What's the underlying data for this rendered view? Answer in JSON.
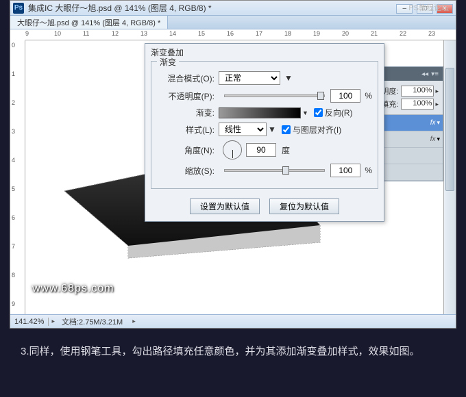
{
  "watermarks": {
    "top_right": "PS教程论坛",
    "bottom_left": "www.68ps.com"
  },
  "window": {
    "app_badge": "Ps",
    "title": "集成IC    大眼仔～旭.psd @ 141% (图层 4, RGB/8) *",
    "btn_min": "–",
    "btn_max": "□",
    "btn_close": "×"
  },
  "tabs": {
    "doc": "大眼仔～旭.psd @ 141% (图层 4, RGB/8) *"
  },
  "ruler_h": [
    "9",
    "10",
    "11",
    "12",
    "13",
    "14",
    "15",
    "16",
    "17",
    "18",
    "19",
    "20",
    "21",
    "22",
    "23"
  ],
  "ruler_v": [
    "0",
    "1",
    "2",
    "3",
    "4",
    "5",
    "6",
    "7",
    "8",
    "9"
  ],
  "statusbar": {
    "zoom": "141.42%",
    "docinfo": "文档:2.75M/3.21M"
  },
  "dialog": {
    "title": "渐变叠加",
    "group_title": "渐变",
    "blend_label": "混合模式(O):",
    "blend_value": "正常",
    "opacity_label": "不透明度(P):",
    "opacity_value": "100",
    "opacity_unit": "%",
    "gradient_label": "渐变:",
    "reverse_label": "反向(R)",
    "style_label": "样式(L):",
    "style_value": "线性",
    "align_label": "与图层对齐(I)",
    "angle_label": "角度(N):",
    "angle_value": "90",
    "angle_unit": "度",
    "scale_label": "缩放(S):",
    "scale_value": "100",
    "scale_unit": "%",
    "btn_default": "设置为默认值",
    "btn_reset": "复位为默认值"
  },
  "panel": {
    "opacity_label": "透明度:",
    "opacity_value": "100%",
    "fill_label": "填充:",
    "fill_value": "100%",
    "fx": "fx"
  },
  "caption": "3.同样，使用钢笔工具，勾出路径填充任意颜色，并为其添加渐变叠加样式，效果如图。"
}
